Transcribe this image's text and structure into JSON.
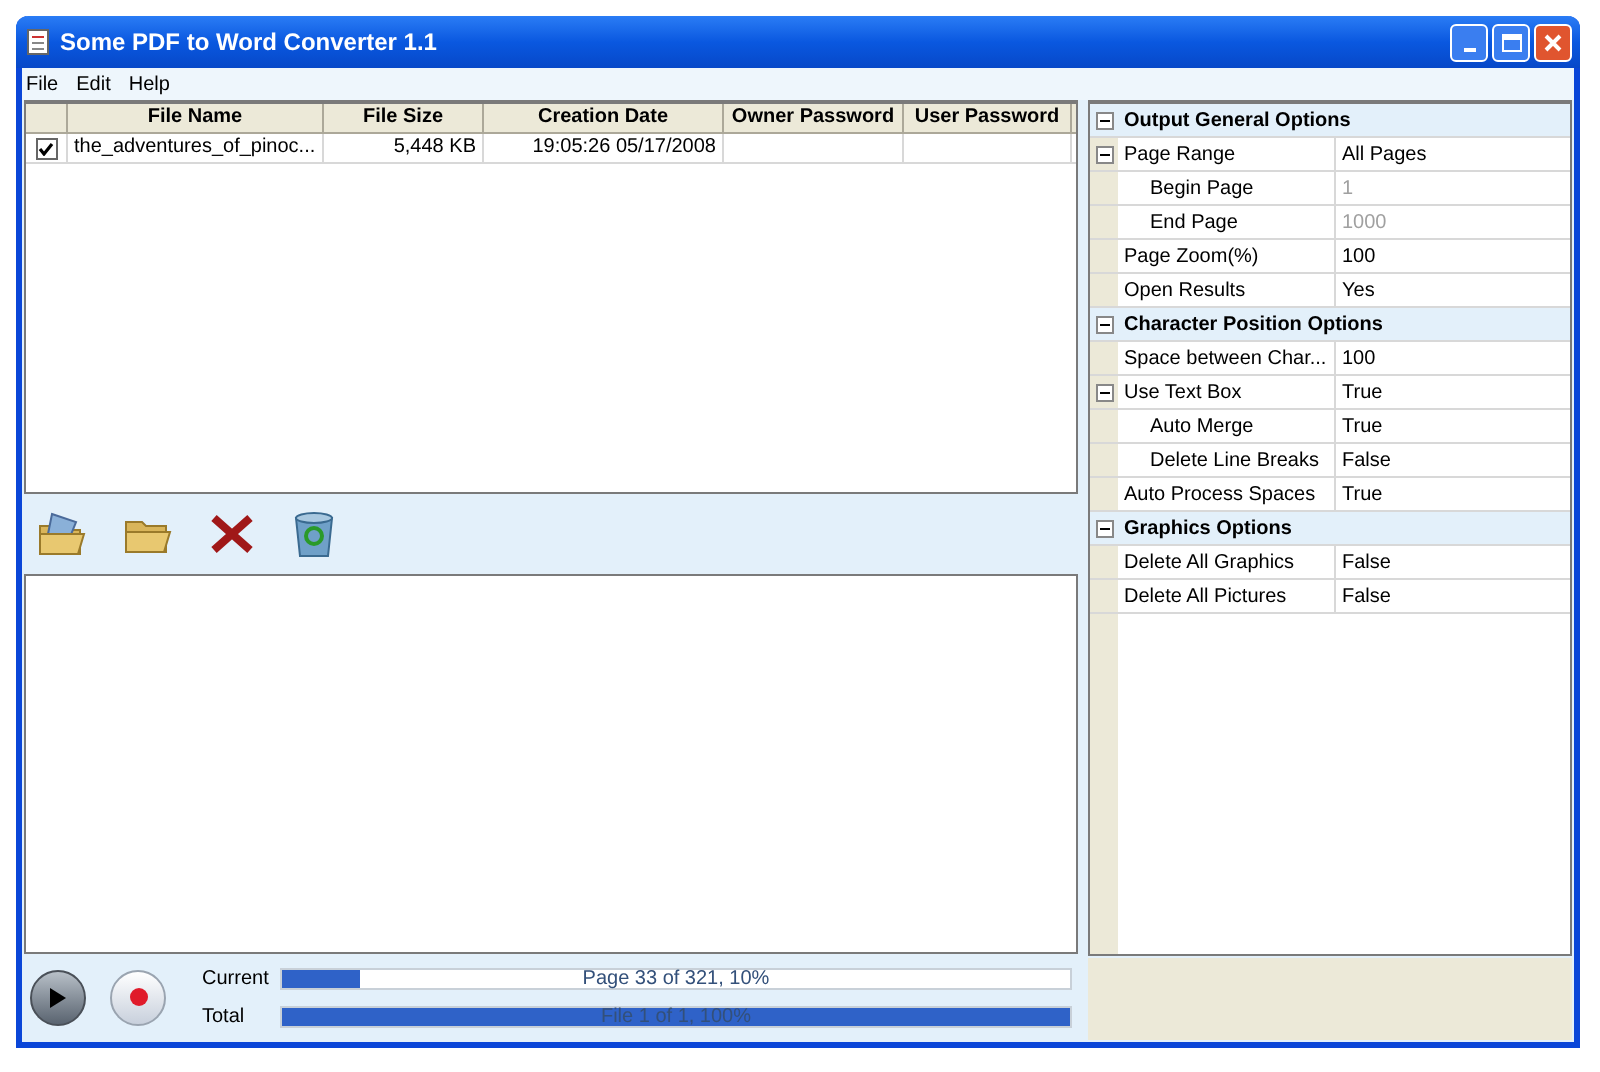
{
  "window": {
    "title": "Some PDF to Word Converter 1.1"
  },
  "menu": [
    "File",
    "Edit",
    "Help"
  ],
  "table": {
    "columns": [
      "File Name",
      "File Size",
      "Creation Date",
      "Owner Password",
      "User Password"
    ],
    "rows": [
      {
        "checked": true,
        "cells": [
          "the_adventures_of_pinoc...",
          "5,448 KB",
          "19:05:26 05/17/2008",
          "",
          ""
        ]
      }
    ]
  },
  "properties": [
    {
      "label": "Output General Options",
      "expanded": true,
      "items": [
        {
          "name": "Page Range",
          "value": "All Pages",
          "expanded": true,
          "children": [
            {
              "name": "Begin Page",
              "value": "1",
              "disabled": true
            },
            {
              "name": "End Page",
              "value": "1000",
              "disabled": true
            }
          ]
        },
        {
          "name": "Page Zoom(%)",
          "value": "100"
        },
        {
          "name": "Open Results",
          "value": "Yes"
        }
      ]
    },
    {
      "label": "Character Position Options",
      "expanded": true,
      "items": [
        {
          "name": "Space between Char...",
          "value": "100"
        },
        {
          "name": "Use Text Box",
          "value": "True",
          "expanded": true,
          "children": [
            {
              "name": "Auto Merge",
              "value": "True",
              "disabled": false
            },
            {
              "name": "Delete Line Breaks",
              "value": "False",
              "disabled": false
            }
          ]
        },
        {
          "name": "Auto Process Spaces",
          "value": "True"
        }
      ]
    },
    {
      "label": "Graphics Options",
      "expanded": true,
      "items": [
        {
          "name": "Delete All Graphics",
          "value": "False"
        },
        {
          "name": "Delete All Pictures",
          "value": "False"
        }
      ]
    }
  ],
  "progress": [
    {
      "label": "Current",
      "level": 0.1,
      "reading": "Page 33 of 321, 10%"
    },
    {
      "label": "Total",
      "level": 1.0,
      "reading": "File 1 of 1, 100%"
    }
  ]
}
